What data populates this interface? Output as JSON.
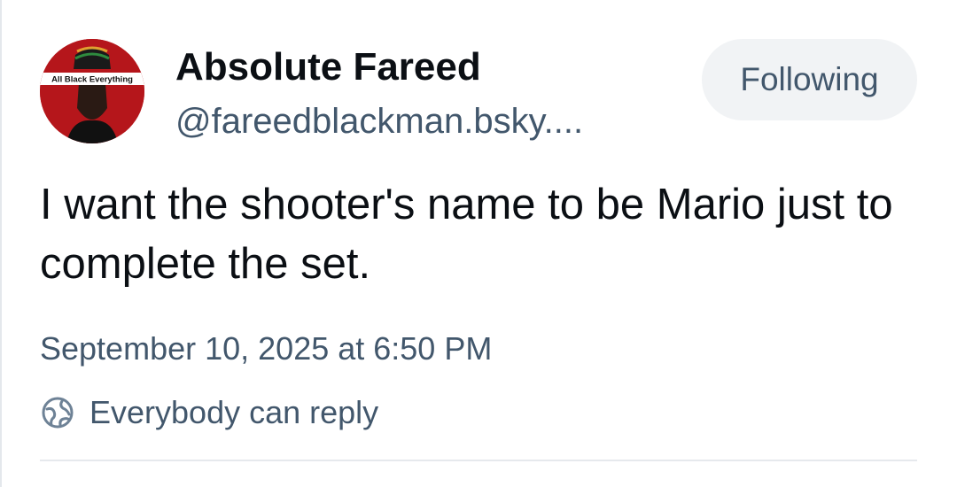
{
  "author": {
    "display_name": "Absolute Fareed",
    "handle": "@fareedblackman.bsky....",
    "avatar_text": "All Black Everything"
  },
  "follow_button": {
    "label": "Following"
  },
  "post": {
    "text": "I want the shooter's name to be Mario just to complete the set.",
    "timestamp": "September 10, 2025 at 6:50 PM",
    "reply_setting": "Everybody can reply"
  },
  "colors": {
    "text_primary": "#0b0f14",
    "text_secondary": "#42576c",
    "button_bg": "#f1f3f5",
    "avatar_red": "#b5161b",
    "divider": "#e6e9ed"
  },
  "icons": {
    "reply_setting_icon": "globe-icon"
  }
}
